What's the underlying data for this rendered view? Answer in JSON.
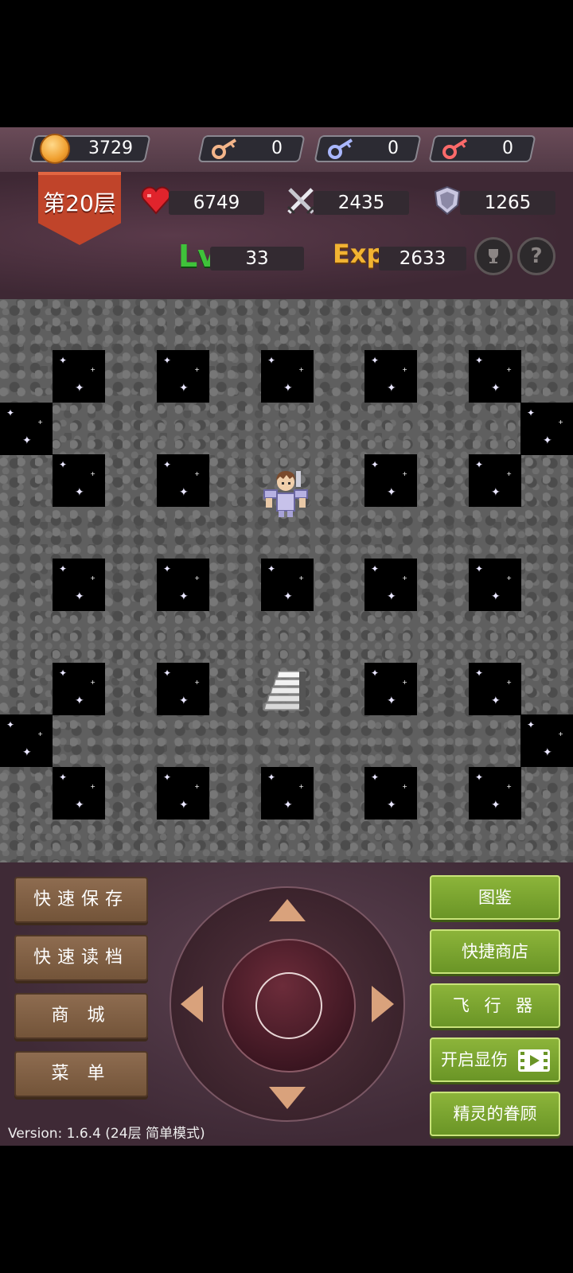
{
  "resources": {
    "gold": "3729",
    "yellow_keys": "0",
    "blue_keys": "0",
    "red_keys": "0"
  },
  "floor": {
    "label": "第20层"
  },
  "stats": {
    "hp": "6749",
    "attack": "2435",
    "defense": "1265",
    "level_label": "Lv",
    "level": "33",
    "exp_label": "Exp",
    "exp": "2633"
  },
  "status_buttons": {
    "help_label": "?"
  },
  "left_menu": {
    "quick_save": "快速保存",
    "quick_load": "快速读档",
    "shop": "商 城",
    "menu": "菜 单"
  },
  "right_menu": {
    "monster_book": "图鉴",
    "quick_shop": "快捷商店",
    "fly": "飞 行 器",
    "show_damage": "开启显伤",
    "fairy_favor": "精灵的眷顾"
  },
  "footer": {
    "version": "Version: 1.6.4 (24层 简单模式)"
  },
  "colors": {
    "key_yellow": "#f4b58a",
    "key_blue": "#aab8ff",
    "key_red": "#ff6a6a",
    "heart": "#e0242c",
    "lv_green": "#3fc23a",
    "exp_gold": "#f2b332"
  }
}
